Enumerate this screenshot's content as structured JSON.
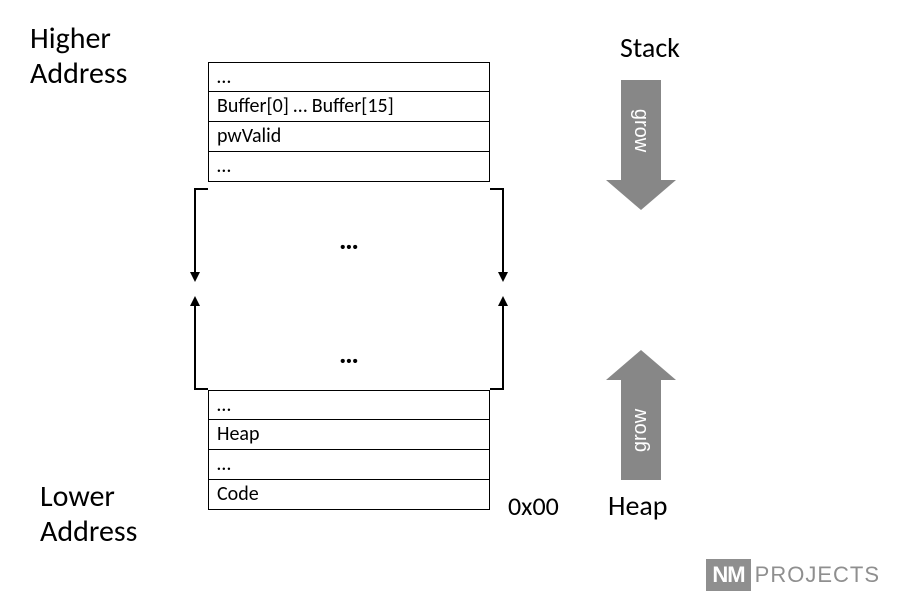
{
  "labels": {
    "higher": "Higher\nAddress",
    "lower": "Lower\nAddress",
    "addr0": "0x00",
    "stack": "Stack",
    "heap": "Heap",
    "grow": "grow",
    "dots": "…"
  },
  "stack_cells": [
    "…",
    "Buffer[0] … Buffer[15]",
    "pwValid",
    "…"
  ],
  "heap_cells": [
    "…",
    "Heap",
    "…",
    "Code"
  ],
  "logo": {
    "nm": "NM",
    "pj": "PROJECTS"
  },
  "colors": {
    "arrow": "#878787",
    "logo_gray": "#8f8f8f"
  }
}
